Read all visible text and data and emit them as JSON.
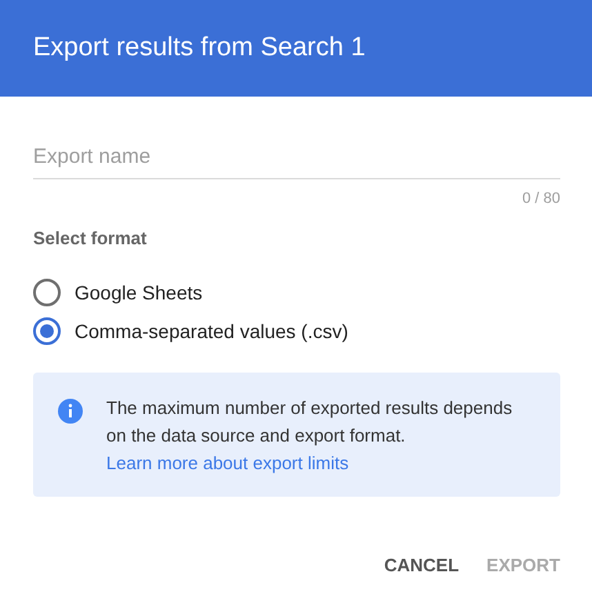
{
  "dialog": {
    "title": "Export results from Search 1"
  },
  "name_field": {
    "placeholder": "Export name",
    "counter": "0 / 80"
  },
  "format": {
    "label": "Select format",
    "options": [
      {
        "label": "Google Sheets",
        "selected": false
      },
      {
        "label": "Comma-separated values (.csv)",
        "selected": true
      }
    ]
  },
  "info": {
    "message": "The maximum number of exported results depends on the data source and export format.",
    "link": "Learn more about export limits"
  },
  "buttons": [
    {
      "label": "CANCEL",
      "disabled": false
    },
    {
      "label": "EXPORT",
      "disabled": true
    }
  ]
}
